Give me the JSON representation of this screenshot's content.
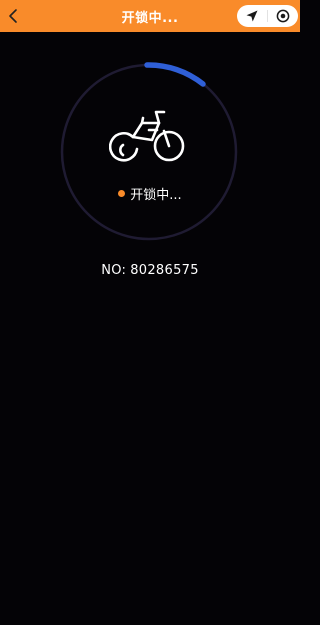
{
  "header": {
    "title": "开锁中...",
    "back_icon": "chevron-left-icon",
    "capsule": {
      "left_icon": "location-arrow-icon",
      "right_icon": "record-target-icon"
    },
    "background_color": "#F98B2A"
  },
  "unlock": {
    "status_text": "开锁中...",
    "status_dot_color": "#F98B2A",
    "progress_color": "#2F5FD7",
    "ring_color": "#1F1B32",
    "icon": "bicycle-icon"
  },
  "bike": {
    "no_label": "NO:",
    "no_value": "80286575"
  }
}
